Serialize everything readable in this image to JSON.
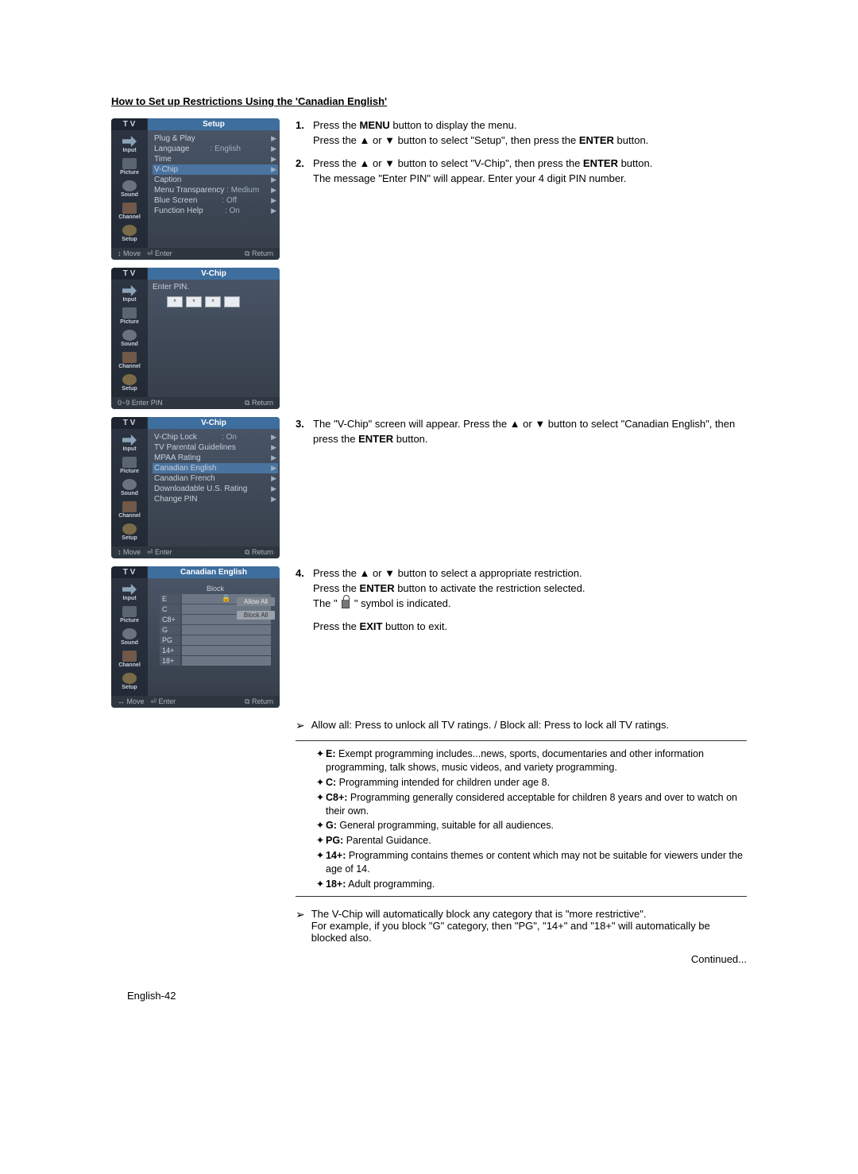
{
  "title": "How to Set up Restrictions Using the 'Canadian English'",
  "sideTabs": [
    "Input",
    "Picture",
    "Sound",
    "Channel",
    "Setup"
  ],
  "panels": {
    "setup": {
      "tv": "T V",
      "header": "Setup",
      "rows": [
        {
          "label": "Plug & Play",
          "val": "",
          "hl": false
        },
        {
          "label": "Language",
          "val": ": English",
          "hl": false
        },
        {
          "label": "Time",
          "val": "",
          "hl": false
        },
        {
          "label": "V-Chip",
          "val": "",
          "hl": true
        },
        {
          "label": "Caption",
          "val": "",
          "hl": false
        },
        {
          "label": "Menu Transparency",
          "val": ": Medium",
          "hl": false
        },
        {
          "label": "Blue Screen",
          "val": ": Off",
          "hl": false
        },
        {
          "label": "Function Help",
          "val": ": On",
          "hl": false
        }
      ],
      "footer": [
        "↕ Move",
        "⏎ Enter",
        "⧉ Return"
      ]
    },
    "pin": {
      "tv": "T V",
      "header": "V-Chip",
      "label": "Enter PIN.",
      "footer": [
        "0~9  Enter PIN",
        "⧉ Return"
      ]
    },
    "vchip": {
      "tv": "T V",
      "header": "V-Chip",
      "rows": [
        {
          "label": "V-Chip Lock",
          "val": ": On",
          "hl": false
        },
        {
          "label": "TV Parental Guidelines",
          "val": "",
          "hl": false
        },
        {
          "label": "MPAA Rating",
          "val": "",
          "hl": false
        },
        {
          "label": "Canadian English",
          "val": "",
          "hl": true
        },
        {
          "label": "Canadian French",
          "val": "",
          "hl": false
        },
        {
          "label": "Downloadable U.S. Rating",
          "val": "",
          "hl": false
        },
        {
          "label": "Change PIN",
          "val": "",
          "hl": false
        }
      ],
      "footer": [
        "↕ Move",
        "⏎ Enter",
        "⧉ Return"
      ]
    },
    "caneng": {
      "tv": "T V",
      "header": "Canadian English",
      "blockHdr": "Block",
      "ratings": [
        "E",
        "C",
        "C8+",
        "G",
        "PG",
        "14+",
        "18+"
      ],
      "allow": "Allow All",
      "block": "Block All",
      "footer": [
        "↔ Move",
        "⏎ Enter",
        "⧉ Return"
      ]
    }
  },
  "steps": {
    "s1a": "Press the ",
    "menu": "MENU",
    "s1b": " button to display the menu.",
    "s1c": "Press the ▲ or ▼ button to select \"Setup\", then press the ",
    "enter": "ENTER",
    "s1d": " button.",
    "s2a": "Press the ▲ or ▼ button to select \"V-Chip\", then press the ",
    "s2b": " button.",
    "s2c": "The message \"Enter PIN\" will appear. Enter your 4 digit PIN number.",
    "s3a": "The \"V-Chip\" screen will appear. Press the ▲ or ▼ button to select \"Canadian English\", then press the ",
    "s3b": " button.",
    "s4a": "Press the ▲ or ▼ button to select a appropriate restriction.",
    "s4b": "Press the ",
    "s4c": " button to activate the restriction selected.",
    "s4d": "The \" ",
    "s4e": " \" symbol is indicated.",
    "s4f": "Press the ",
    "exit": "EXIT",
    "s4g": " button to exit."
  },
  "notes": {
    "allowblock": "Allow all: Press to unlock all TV ratings. / Block all: Press to lock all TV ratings.",
    "defs": [
      {
        "k": "E:",
        "t": " Exempt programming includes...news, sports, documentaries and other information programming, talk shows, music videos, and variety programming."
      },
      {
        "k": "C:",
        "t": " Programming intended for children under age 8."
      },
      {
        "k": "C8+:",
        "t": " Programming generally considered acceptable for children 8 years and over to watch on their own."
      },
      {
        "k": "G:",
        "t": " General programming, suitable for all audiences."
      },
      {
        "k": "PG:",
        "t": " Parental Guidance."
      },
      {
        "k": "14+:",
        "t": " Programming contains themes or content which may not be suitable for viewers under the age of 14."
      },
      {
        "k": "18+:",
        "t": " Adult programming."
      }
    ],
    "auto1": "The V-Chip will automatically block any category that is \"more restrictive\".",
    "auto2": "For example, if you block \"G\" category, then \"PG\", \"14+\" and \"18+\" will automatically be blocked also."
  },
  "continued": "Continued...",
  "pagenum": "English-42"
}
